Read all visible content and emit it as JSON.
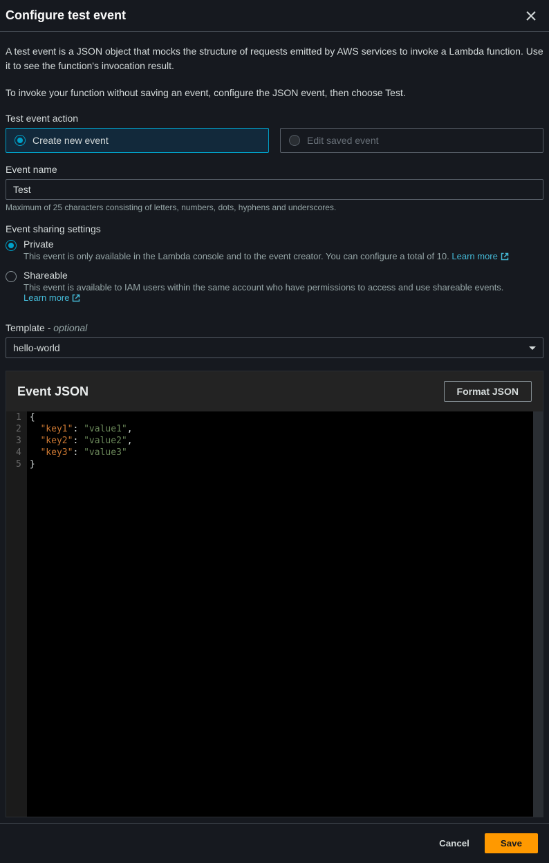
{
  "header": {
    "title": "Configure test event"
  },
  "intro": {
    "p1": "A test event is a JSON object that mocks the structure of requests emitted by AWS services to invoke a Lambda function. Use it to see the function's invocation result.",
    "p2": "To invoke your function without saving an event, configure the JSON event, then choose Test."
  },
  "action": {
    "label": "Test event action",
    "create": "Create new event",
    "edit": "Edit saved event"
  },
  "event_name": {
    "label": "Event name",
    "value": "Test",
    "hint": "Maximum of 25 characters consisting of letters, numbers, dots, hyphens and underscores."
  },
  "sharing": {
    "label": "Event sharing settings",
    "private": {
      "title": "Private",
      "desc": "This event is only available in the Lambda console and to the event creator. You can configure a total of 10.",
      "learn": "Learn more"
    },
    "shareable": {
      "title": "Shareable",
      "desc": "This event is available to IAM users within the same account who have permissions to access and use shareable events.",
      "learn": "Learn more"
    }
  },
  "template": {
    "label_prefix": "Template - ",
    "label_optional": "optional",
    "value": "hello-world"
  },
  "editor": {
    "title": "Event JSON",
    "format_btn": "Format JSON",
    "lines": {
      "l1_open": "{",
      "l2_key": "\"key1\"",
      "l2_val": "\"value1\"",
      "l3_key": "\"key2\"",
      "l3_val": "\"value2\"",
      "l4_key": "\"key3\"",
      "l4_val": "\"value3\"",
      "l5_close": "}"
    },
    "line_numbers": [
      "1",
      "2",
      "3",
      "4",
      "5"
    ]
  },
  "footer": {
    "cancel": "Cancel",
    "save": "Save"
  }
}
